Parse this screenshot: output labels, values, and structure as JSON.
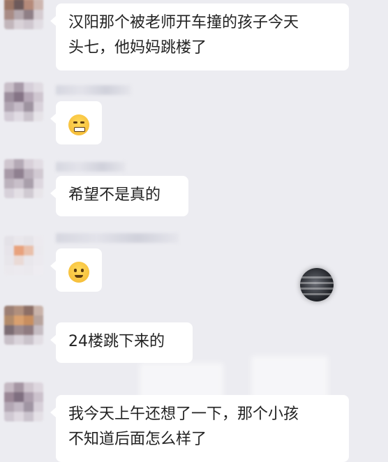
{
  "chat": {
    "messages": [
      {
        "lines": [
          "汉阳那个被老师开车撞的孩子今天",
          "头七，他妈妈跳楼了"
        ]
      },
      {
        "emoji": "grimace-emoji"
      },
      {
        "lines": [
          "希望不是真的"
        ]
      },
      {
        "emoji": "smile-emoji"
      },
      {
        "lines": [
          "24楼跳下来的"
        ]
      },
      {
        "lines": [
          "我今天上午还想了一下，那个小孩",
          "不知道后面怎么样了"
        ]
      }
    ]
  },
  "colors": {
    "background": "#ececf1",
    "bubble": "#ffffff",
    "text": "#222222",
    "emoji_face": "#f4b731"
  },
  "icons": [
    "grimace-emoji",
    "smile-emoji",
    "floating-ball-icon"
  ]
}
